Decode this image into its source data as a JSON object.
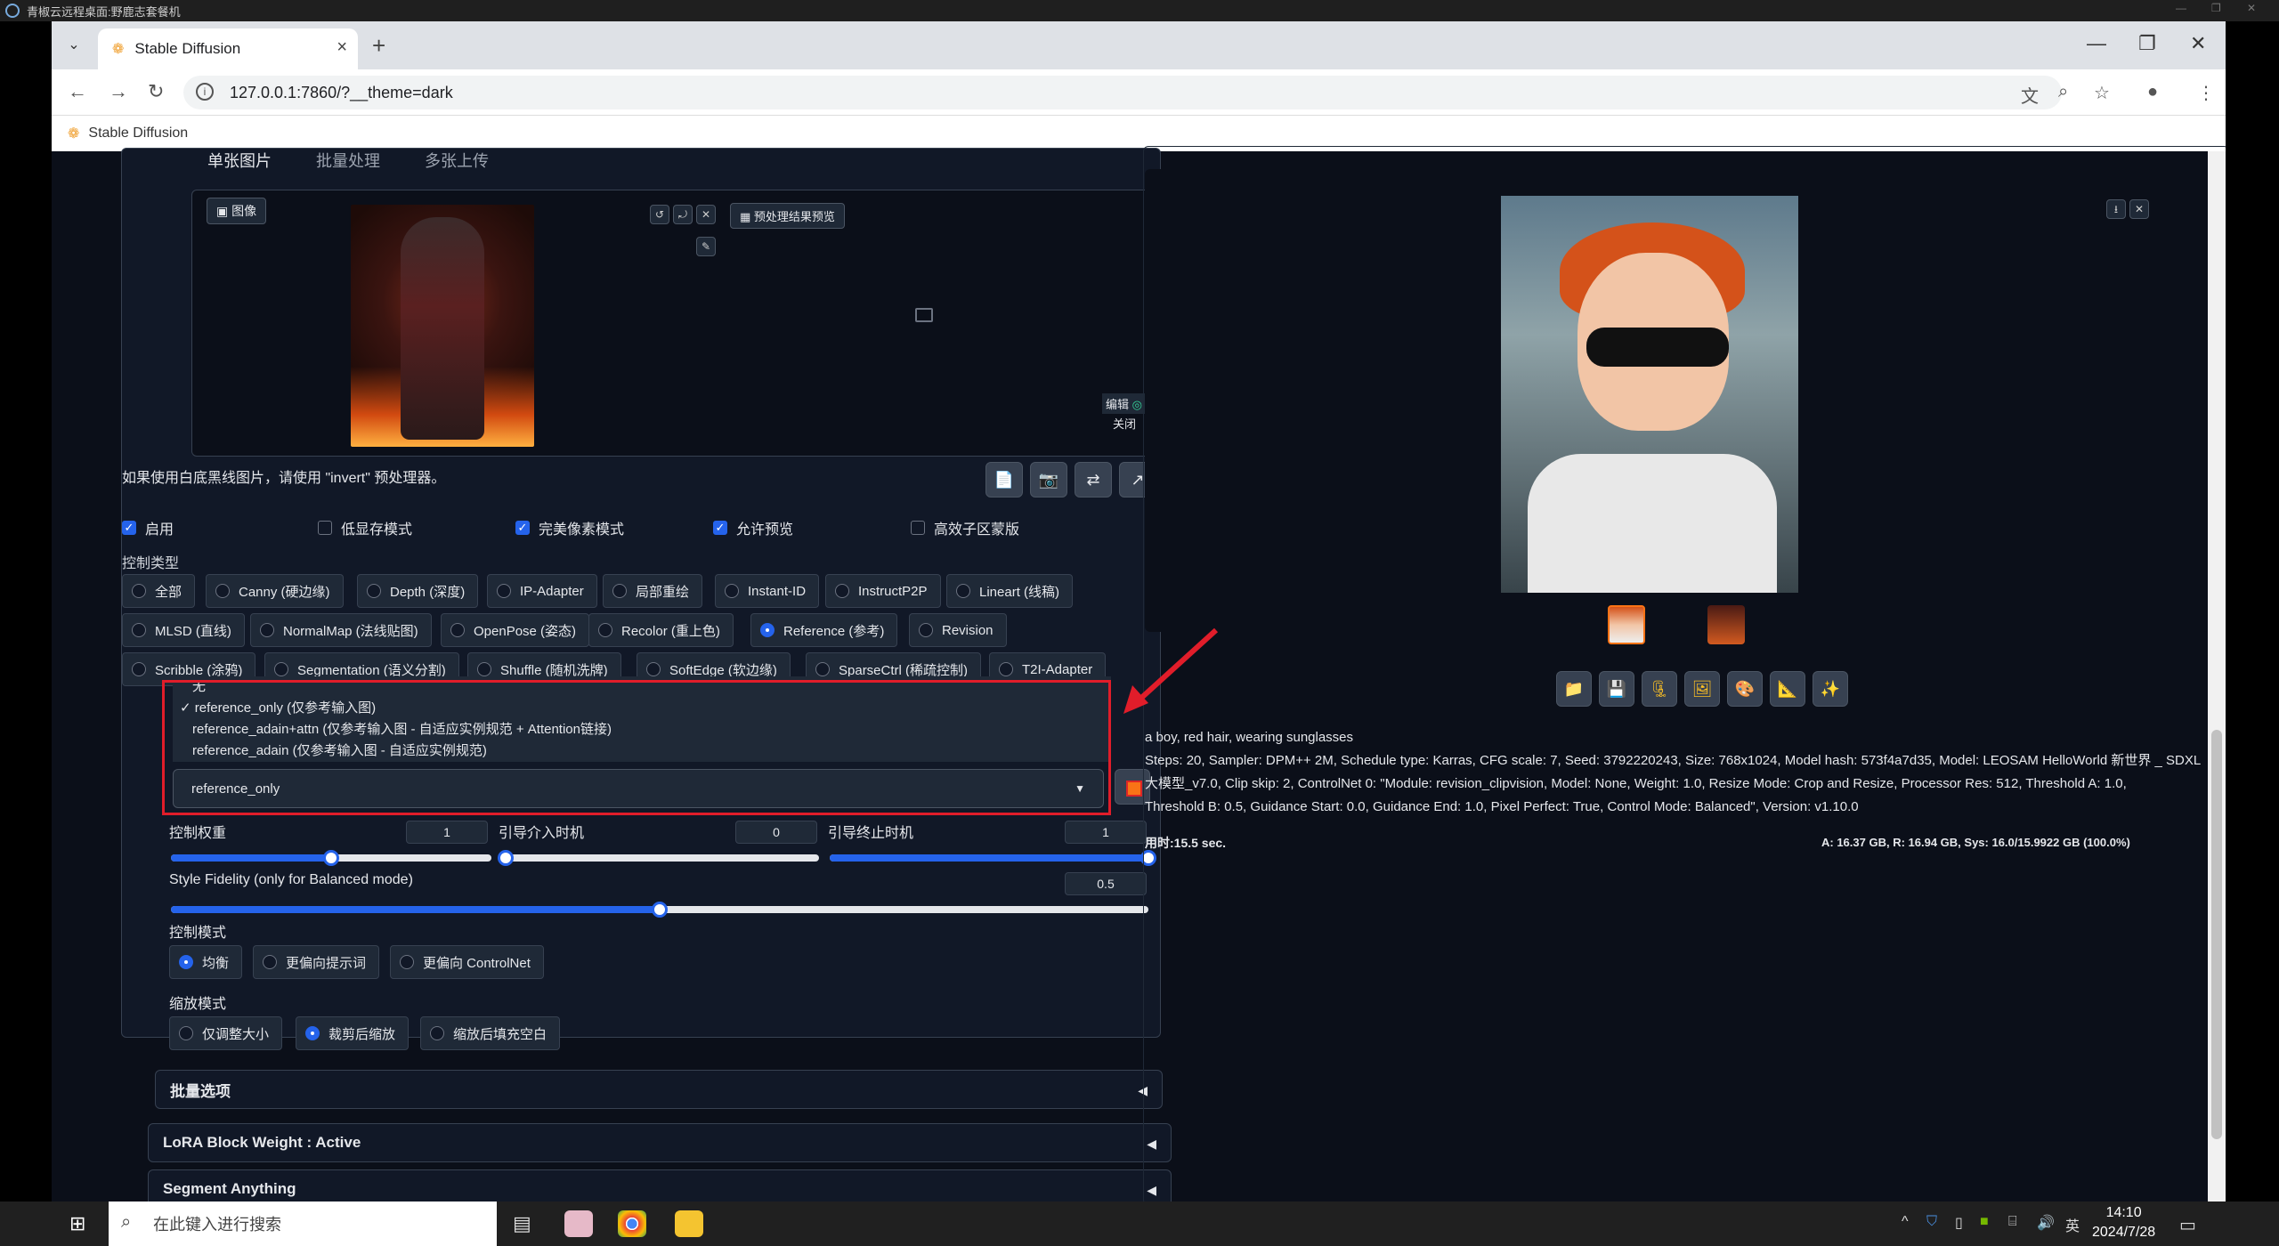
{
  "remote_title": "青椒云远程桌面:野鹿志套餐机",
  "browser": {
    "tab_title": "Stable Diffusion",
    "url": "127.0.0.1:7860/?__theme=dark",
    "bookmark": "Stable Diffusion"
  },
  "left": {
    "tabs": [
      "单张图片",
      "批量处理",
      "多张上传"
    ],
    "image_label": "图像",
    "preview_button": "预处理结果预览",
    "edit_label": "编辑",
    "close_label": "关闭",
    "hint": "如果使用白底黑线图片，请使用 \"invert\" 预处理器。",
    "checkboxes": [
      {
        "label": "启用",
        "checked": true
      },
      {
        "label": "低显存模式",
        "checked": false
      },
      {
        "label": "完美像素模式",
        "checked": true
      },
      {
        "label": "允许预览",
        "checked": true
      },
      {
        "label": "高效子区蒙版",
        "checked": false
      }
    ],
    "control_type_label": "控制类型",
    "control_types_row1": [
      "全部",
      "Canny (硬边缘)",
      "Depth (深度)",
      "IP-Adapter",
      "局部重绘",
      "Instant-ID",
      "InstructP2P",
      "Lineart (线稿)"
    ],
    "control_types_row2": [
      "MLSD (直线)",
      "NormalMap (法线贴图)",
      "OpenPose (姿态)",
      "Recolor (重上色)",
      "Reference (参考)",
      "Revision"
    ],
    "control_types_row3": [
      "Scribble (涂鸦)",
      "Segmentation (语义分割)",
      "Shuffle (随机洗牌)",
      "SoftEdge (软边缘)",
      "SparseCtrl (稀疏控制)",
      "T2I-Adapter"
    ],
    "selected_control_type": "Reference (参考)",
    "dropdown_options": [
      "无",
      "reference_only (仅参考输入图)",
      "reference_adain+attn (仅参考输入图 - 自适应实例规范 + Attention链接)",
      "reference_adain (仅参考输入图 - 自适应实例规范)"
    ],
    "dropdown_selected": "reference_only",
    "weight_label": "控制权重",
    "weight_value": "1",
    "weight_fraction": 0.5,
    "start_label": "引导介入时机",
    "start_value": "0",
    "end_label": "引导终止时机",
    "end_value": "1",
    "fidelity_label": "Style Fidelity (only for Balanced mode)",
    "fidelity_value": "0.5",
    "control_mode_label": "控制模式",
    "control_modes": [
      "均衡",
      "更偏向提示词",
      "更偏向 ControlNet"
    ],
    "resize_mode_label": "缩放模式",
    "resize_modes": [
      "仅调整大小",
      "裁剪后缩放",
      "缩放后填充空白"
    ],
    "accordions": [
      "批量选项",
      "LoRA Block Weight : Active",
      "Segment Anything"
    ]
  },
  "right": {
    "prompt": "a boy, red hair, wearing sunglasses",
    "params_line1": "Steps: 20, Sampler: DPM++ 2M, Schedule type: Karras, CFG scale: 7, Seed: 3792220243, Size: 768x1024, Model hash: 573f4a7d35, Model: LEOSAM HelloWorld 新世界 _ SDXL",
    "params_line2": "大模型_v7.0, Clip skip: 2, ControlNet 0: \"Module: revision_clipvision, Model: None, Weight: 1.0, Resize Mode: Crop and Resize, Processor Res: 512, Threshold A: 1.0,",
    "params_line3": "Threshold B: 0.5, Guidance Start: 0.0, Guidance End: 1.0, Pixel Perfect: True, Control Mode: Balanced\", Version: v1.10.0",
    "time": "用时:15.5 sec.",
    "vram": "A: 16.37 GB, R: 16.94 GB, Sys: 16.0/15.9922 GB (100.0%)"
  },
  "taskbar": {
    "search_placeholder": "在此键入进行搜索",
    "time": "14:10",
    "date": "2024/7/28",
    "ime": "英"
  },
  "colors": {
    "accent": "#2563eb",
    "highlight": "#e11d2a",
    "bg": "#0b0f19"
  }
}
